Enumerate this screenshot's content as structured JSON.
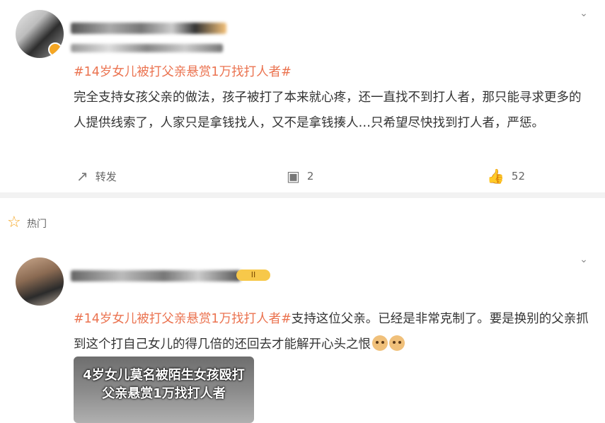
{
  "post1": {
    "content_hashtag": "#14岁女儿被打父亲悬赏1万找打人者#",
    "content_text": "完全支持女孩父亲的做法，孩子被打了本来就心疼，还一直找不到打人者，那只能寻求更多的人提供线索了，人家只是拿钱找人，又不是拿钱揍人…只希望尽快找到打人者，严惩。",
    "actions": {
      "repost_label": "转发",
      "comment_count": "2",
      "like_count": "52"
    }
  },
  "hot_section": {
    "label": "热门"
  },
  "post2": {
    "level_badge": "II",
    "content_hashtag": "#14岁女儿被打父亲悬赏1万找打人者#",
    "content_text": "支持这位父亲。已经是非常克制了。要是换别的父亲抓到这个打自己女儿的得几倍的还回去才能解开心头之恨",
    "thumbnail": {
      "line1": "4岁女儿莫名被陌生女孩殴打",
      "line2": "父亲悬赏1万找打人者"
    }
  },
  "colors": {
    "hashtag": "#eb7350",
    "text": "#333333",
    "muted": "#666666",
    "accent": "#f5a623"
  },
  "icons": {
    "repost": "repost-icon",
    "comment": "comment-icon",
    "like": "thumbs-up-icon",
    "hot": "star-icon",
    "more": "chevron-down-icon"
  }
}
